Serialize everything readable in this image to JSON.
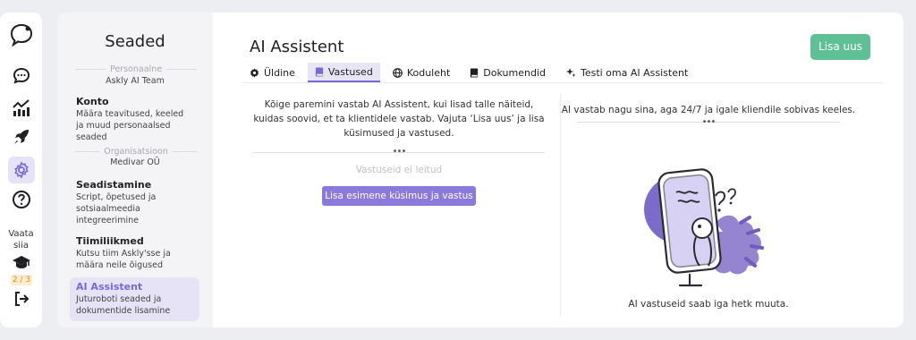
{
  "rail": {
    "items": [
      {
        "icon": "logo-bubble-icon"
      },
      {
        "icon": "chat-icon"
      },
      {
        "icon": "analytics-icon"
      },
      {
        "icon": "rocket-icon"
      },
      {
        "icon": "settings-gear-icon"
      },
      {
        "icon": "help-icon"
      }
    ],
    "vaata_label": "Vaata siia",
    "progress_badge": "2 / 3",
    "progress_value": 0.6667,
    "icons_after": [
      "graduation-cap-icon",
      "logout-icon"
    ],
    "colors": {
      "icon": "#1f1f24",
      "active_bg": "#e6e3f7",
      "active_icon": "#7b68d6"
    }
  },
  "sidebar": {
    "title": "Seaded",
    "sections": [
      {
        "label": "Personaalne",
        "org": "Askly AI Team"
      },
      {
        "label": "Organisatsioon",
        "org": "Medivar OÜ"
      }
    ],
    "items": [
      {
        "title": "Konto",
        "desc": "Määra teavitused, keeled ja muud personaalsed seaded"
      },
      {
        "title": "Seadistamine",
        "desc": "Script, õpetused ja sotsiaalmeedia integreerimine"
      },
      {
        "title": "Tiimiliikmed",
        "desc": "Kutsu tiim Askly'sse ja määra neile õigused"
      },
      {
        "title": "AI Assistent",
        "desc": "Juturoboti seaded ja dokumentide lisamine",
        "active": true
      }
    ]
  },
  "main": {
    "title": "AI Assistent",
    "add_button": "Lisa uus",
    "tabs": [
      {
        "label": "Üldine",
        "icon": "gear-icon"
      },
      {
        "label": "Vastused",
        "icon": "book-icon",
        "active": true
      },
      {
        "label": "Koduleht",
        "icon": "globe-icon"
      },
      {
        "label": "Dokumendid",
        "icon": "document-book-icon"
      },
      {
        "label": "Testi oma AI Assistent",
        "icon": "sparkle-icon"
      }
    ],
    "left": {
      "intro": "Kõige paremini vastab AI Assistent, kui lisad talle näiteid, kuidas soovid, et ta klientidele vastab. Vajuta ‘Lisa uus’ ja lisa küsimused ja vastused.",
      "empty": "Vastuseid ei leitud",
      "primary_button": "Lisa esimene küsimus ja vastus"
    },
    "right": {
      "hint": "AI vastab nagu sina, aga 24/7 ja igale kliendile sobivas keeles.",
      "caption": "AI vastuseid saab iga hetk muuta."
    }
  },
  "colors": {
    "accent": "#7b68d6",
    "green": "#5fbf95",
    "primary_button": "#8c79dc",
    "sidebar_bg": "#f4f4f6",
    "page_bg": "#eceef2"
  }
}
